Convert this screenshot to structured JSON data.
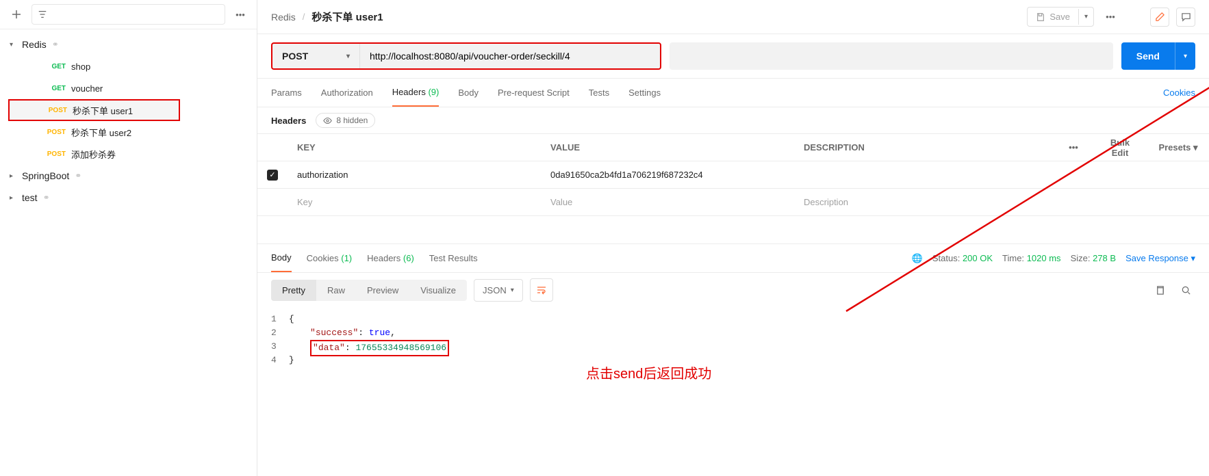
{
  "sidebar": {
    "folders": [
      {
        "name": "Redis",
        "expanded": true
      },
      {
        "name": "SpringBoot",
        "expanded": false
      },
      {
        "name": "test",
        "expanded": false
      }
    ],
    "requests": [
      {
        "method": "GET",
        "name": "shop",
        "active": false
      },
      {
        "method": "GET",
        "name": "voucher",
        "active": false
      },
      {
        "method": "POST",
        "name": "秒杀下单 user1",
        "active": true
      },
      {
        "method": "POST",
        "name": "秒杀下单 user2",
        "active": false
      },
      {
        "method": "POST",
        "name": "添加秒杀券",
        "active": false
      }
    ]
  },
  "breadcrumb": {
    "root": "Redis",
    "name": "秒杀下单 user1"
  },
  "save_label": "Save",
  "request": {
    "method": "POST",
    "url": "http://localhost:8080/api/voucher-order/seckill/4",
    "send_label": "Send"
  },
  "tabs": {
    "params": "Params",
    "auth": "Authorization",
    "headers": "Headers",
    "headers_count": "(9)",
    "body": "Body",
    "prereq": "Pre-request Script",
    "tests": "Tests",
    "settings": "Settings",
    "cookies": "Cookies"
  },
  "headers_section": {
    "label": "Headers",
    "hidden_label": "8 hidden",
    "cols": {
      "key": "KEY",
      "value": "VALUE",
      "desc": "DESCRIPTION",
      "bulk": "Bulk Edit",
      "presets": "Presets"
    },
    "row": {
      "key": "authorization",
      "value": "0da91650ca2b4fd1a706219f687232c4"
    },
    "placeholder": {
      "key": "Key",
      "value": "Value",
      "desc": "Description"
    }
  },
  "response": {
    "tabs": {
      "body": "Body",
      "cookies": "Cookies",
      "cookies_count": "(1)",
      "headers": "Headers",
      "headers_count": "(6)",
      "tests": "Test Results"
    },
    "status_label": "Status:",
    "status_value": "200 OK",
    "time_label": "Time:",
    "time_value": "1020 ms",
    "size_label": "Size:",
    "size_value": "278 B",
    "save_label": "Save Response",
    "views": {
      "pretty": "Pretty",
      "raw": "Raw",
      "preview": "Preview",
      "visualize": "Visualize"
    },
    "format": "JSON",
    "json": {
      "success_key": "\"success\"",
      "success_val": "true",
      "data_key": "\"data\"",
      "data_val": "17655334948569106"
    }
  },
  "annotation": "点击send后返回成功"
}
